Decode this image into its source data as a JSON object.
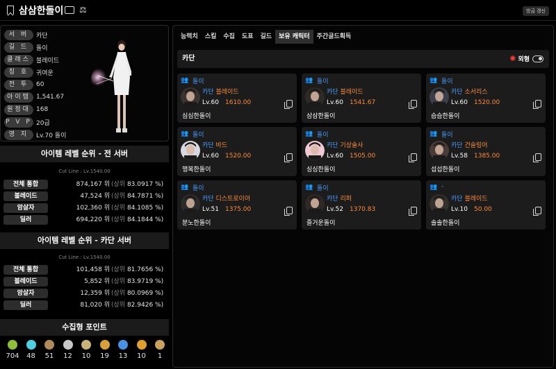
{
  "header": {
    "title": "삼삼한돌이",
    "refresh_label": "방금 갱신"
  },
  "profile": {
    "rows": [
      {
        "label": "서 버",
        "value": "카단"
      },
      {
        "label": "길 드",
        "value": "돌이"
      },
      {
        "label": "클래스",
        "value": "블레이드"
      },
      {
        "label": "칭 호",
        "value": "귀여운"
      },
      {
        "label": "전 투",
        "value": "60"
      },
      {
        "label": "아이템",
        "value": "1,541.67"
      },
      {
        "label": "원정대",
        "value": "168"
      },
      {
        "label": "P V P",
        "value": "20급"
      },
      {
        "label": "영 지",
        "value": "Lv.70 돌이"
      }
    ]
  },
  "ranking_all": {
    "title": "아이템 레벨 순위 - 전 서버",
    "cutline": "Cut Line : Lv.1540.00",
    "rows": [
      {
        "label": "전체 통합",
        "rank": "874,167",
        "unit": "위",
        "pct_prefix": "(상위",
        "pct": "83.0917 %)"
      },
      {
        "label": "블레이드",
        "rank": "47,524",
        "unit": "위",
        "pct_prefix": "(상위",
        "pct": "84.7871 %)"
      },
      {
        "label": "암살자",
        "rank": "102,360",
        "unit": "위",
        "pct_prefix": "(상위",
        "pct": "84.1085 %)"
      },
      {
        "label": "딜러",
        "rank": "694,220",
        "unit": "위",
        "pct_prefix": "(상위",
        "pct": "84.1844 %)"
      }
    ]
  },
  "ranking_server": {
    "title": "아이템 레벨 순위 - 카단 서버",
    "cutline": "Cut Line : Lv.1540.00",
    "rows": [
      {
        "label": "전체 통합",
        "rank": "101,458",
        "unit": "위",
        "pct_prefix": "(상위",
        "pct": "81.7656 %)"
      },
      {
        "label": "블레이드",
        "rank": "5,852",
        "unit": "위",
        "pct_prefix": "(상위",
        "pct": "83.9719 %)"
      },
      {
        "label": "암살자",
        "rank": "12,359",
        "unit": "위",
        "pct_prefix": "(상위",
        "pct": "80.0969 %)"
      },
      {
        "label": "딜러",
        "rank": "81,020",
        "unit": "위",
        "pct_prefix": "(상위",
        "pct": "82.9426 %)"
      }
    ]
  },
  "collection": {
    "title": "수집형 포인트",
    "items": [
      {
        "icon": "mokoko-seed-icon",
        "color": "#8fbf3a",
        "count": "704"
      },
      {
        "icon": "island-heart-icon",
        "color": "#4fd0e0",
        "count": "48"
      },
      {
        "icon": "great-art-icon",
        "color": "#b08a5a",
        "count": "51"
      },
      {
        "icon": "giant-heart-icon",
        "color": "#c8c8c8",
        "count": "12"
      },
      {
        "icon": "ignea-token-icon",
        "color": "#c9b37a",
        "count": "10"
      },
      {
        "icon": "voyage-icon",
        "color": "#d8a03a",
        "count": "19"
      },
      {
        "icon": "world-tree-leaf-icon",
        "color": "#4a90e2",
        "count": "13"
      },
      {
        "icon": "orpheus-star-icon",
        "color": "#e0a030",
        "count": "10"
      },
      {
        "icon": "memory-icon",
        "color": "#caa060",
        "count": "1"
      }
    ]
  },
  "tabs": [
    {
      "label": "능력치",
      "active": false
    },
    {
      "label": "스킬",
      "active": false
    },
    {
      "label": "수집",
      "active": false
    },
    {
      "label": "도표",
      "active": false
    },
    {
      "label": "길드",
      "active": false
    },
    {
      "label": "보유 캐릭터",
      "active": true
    },
    {
      "label": "주간골드획득",
      "active": false
    }
  ],
  "server_bar": {
    "name": "카단",
    "toggle_label": "외형"
  },
  "characters": [
    {
      "guild": "돌이",
      "server": "카단",
      "class": "블레이드",
      "level": "Lv.60",
      "item_level": "1610.00",
      "name": "심심한돌이"
    },
    {
      "guild": "돌이",
      "server": "카단",
      "class": "블레이드",
      "level": "Lv.60",
      "item_level": "1541.67",
      "name": "삼삼한돌이"
    },
    {
      "guild": "돌이",
      "server": "카단",
      "class": "소서리스",
      "level": "Lv.60",
      "item_level": "1520.00",
      "name": "슴슴한돌이"
    },
    {
      "guild": "돌이",
      "server": "카단",
      "class": "바드",
      "level": "Lv.60",
      "item_level": "1520.00",
      "name": "행복한돌이"
    },
    {
      "guild": "돌이",
      "server": "카단",
      "class": "기상술사",
      "level": "Lv.60",
      "item_level": "1505.00",
      "name": "싱싱한돌이"
    },
    {
      "guild": "돌이",
      "server": "카단",
      "class": "건슬링어",
      "level": "Lv.58",
      "item_level": "1385.00",
      "name": "섭섭한돌이"
    },
    {
      "guild": "돌이",
      "server": "카단",
      "class": "디스트로이어",
      "level": "Lv.51",
      "item_level": "1375.00",
      "name": "분노한돌이"
    },
    {
      "guild": "돌이",
      "server": "카단",
      "class": "리퍼",
      "level": "Lv.52",
      "item_level": "1370.83",
      "name": "즐거운돌이"
    },
    {
      "guild": "-",
      "server": "카단",
      "class": "블레이드",
      "level": "Lv.10",
      "item_level": "50.00",
      "name": "솔솔한돌이"
    }
  ]
}
